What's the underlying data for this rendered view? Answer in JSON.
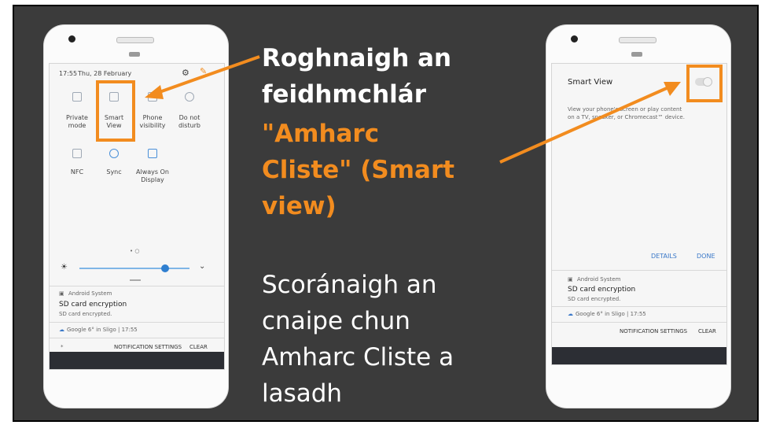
{
  "slide": {
    "instruction_1": {
      "line1": "Roghnaigh an",
      "line2": "feidhmchlár",
      "line3": "\"Amharc",
      "line4": "Cliste\" (Smart",
      "line5": "view)"
    },
    "instruction_2": {
      "line1": "Scoránaigh an",
      "line2": "cnaipe chun",
      "line3": "Amharc Cliste a",
      "line4": "lasadh"
    },
    "colors": {
      "background": "#3b3b3b",
      "accent": "#f28c1f",
      "text": "#ffffff"
    }
  },
  "left_phone": {
    "status": {
      "time": "17:55",
      "date": "Thu, 28 February"
    },
    "quick_tiles": [
      {
        "label1": "Private",
        "label2": "mode",
        "icon": "private-mode-icon"
      },
      {
        "label1": "Smart",
        "label2": "View",
        "icon": "smart-view-icon"
      },
      {
        "label1": "Phone",
        "label2": "visibility",
        "icon": "phone-visibility-icon"
      },
      {
        "label1": "Do not",
        "label2": "disturb",
        "icon": "do-not-disturb-icon"
      },
      {
        "label1": "NFC",
        "label2": "",
        "icon": "nfc-icon"
      },
      {
        "label1": "Sync",
        "label2": "",
        "icon": "sync-icon"
      },
      {
        "label1": "Always On",
        "label2": "Display",
        "icon": "always-on-display-icon"
      }
    ],
    "page_dots": "• ○",
    "notification": {
      "source": "Android System",
      "title": "SD card encryption",
      "body": "SD card encrypted.",
      "google_line": "Google  6° in Sligo  |  17:55",
      "settings": "NOTIFICATION SETTINGS",
      "clear": "CLEAR",
      "star": "*"
    }
  },
  "right_phone": {
    "title": "Smart View",
    "description_line1": "View your phone's screen or play content",
    "description_line2": "on a TV, speaker, or Chromecast™ device.",
    "details": "DETAILS",
    "done": "DONE",
    "notification": {
      "source": "Android System",
      "title": "SD card encryption",
      "body": "SD card encrypted.",
      "google_line": "Google  6° in Sligo  |  17:55",
      "settings": "NOTIFICATION SETTINGS",
      "clear": "CLEAR"
    }
  }
}
